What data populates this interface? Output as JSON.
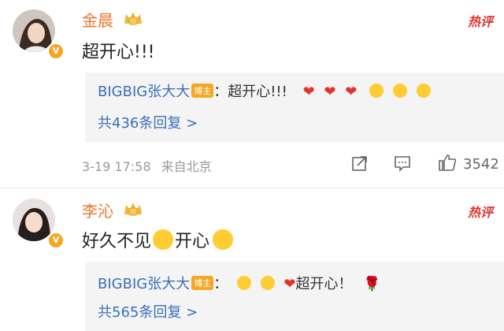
{
  "comments": [
    {
      "author": "金晨",
      "hot_label": "热评",
      "text": "超开心!!!",
      "reply": {
        "author": "BIGBIG张大大",
        "tag": "博主",
        "sep": "：",
        "text": "超开心!!!",
        "count_label": "共436条回复 >"
      },
      "timestamp": "3-19 17:58",
      "location": "来自北京",
      "like_count": "3542"
    },
    {
      "author": "李沁",
      "hot_label": "热评",
      "text_a": "好久不见",
      "text_b": "开心",
      "reply": {
        "author": "BIGBIG张大大",
        "tag": "博主",
        "sep": "：",
        "text": "超开心！",
        "count_label": "共565条回复 >"
      }
    }
  ],
  "icons": [
    "crown-badge-icon",
    "verified-icon",
    "heart-icon",
    "hug-emoji-icon",
    "crying-laughing-emoji-icon",
    "surprised-emoji-icon",
    "rose-icon",
    "share-icon",
    "comment-icon",
    "like-icon"
  ],
  "colors": {
    "name": "#e8742c",
    "hot": "#e2332d",
    "link": "#3b6fb8",
    "badge": "#f5a623"
  }
}
